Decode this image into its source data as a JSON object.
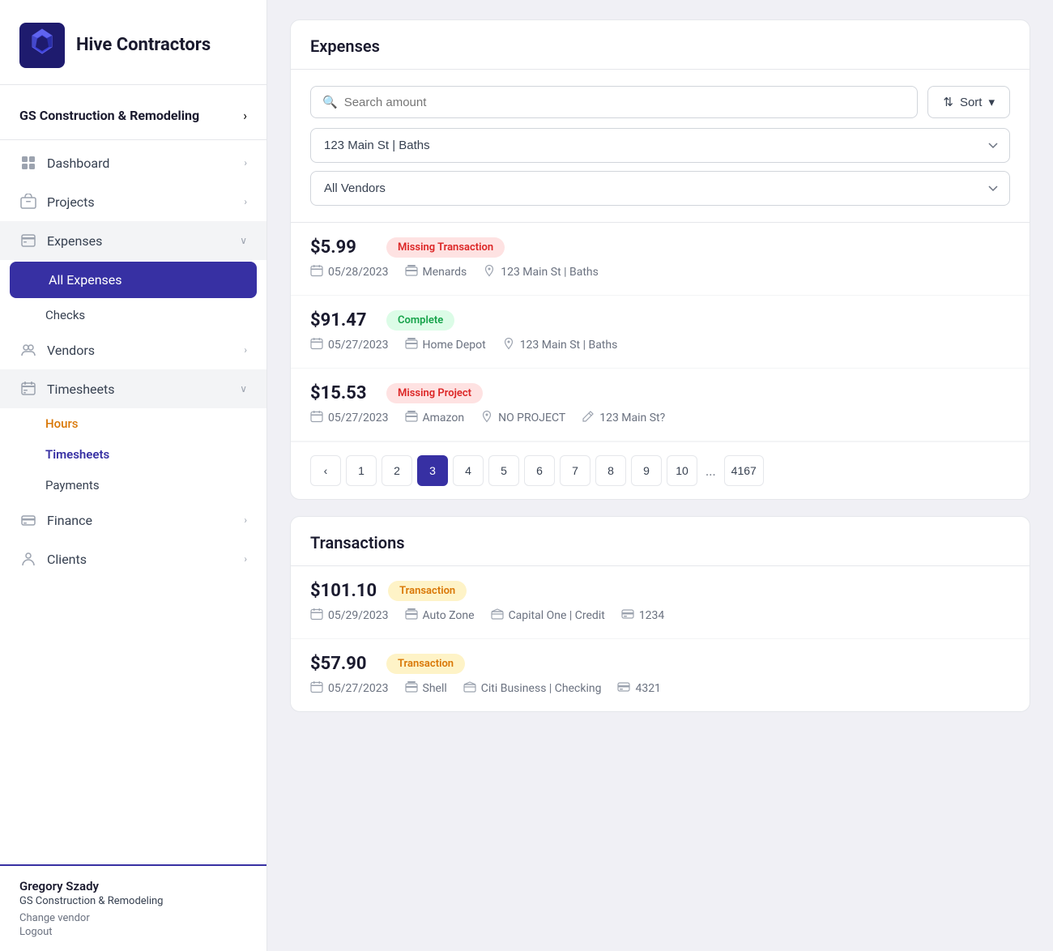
{
  "sidebar": {
    "brand": "Hive Contractors",
    "org": {
      "name": "GS Construction & Remodeling",
      "chevron": "›"
    },
    "nav_items": [
      {
        "id": "dashboard",
        "label": "Dashboard",
        "icon": "dashboard",
        "has_chevron": true
      },
      {
        "id": "projects",
        "label": "Projects",
        "icon": "projects",
        "has_chevron": true
      },
      {
        "id": "expenses",
        "label": "Expenses",
        "icon": "expenses",
        "has_chevron": true,
        "expanded": true
      },
      {
        "id": "all-expenses",
        "label": "All Expenses",
        "active": true
      },
      {
        "id": "checks",
        "label": "Checks"
      },
      {
        "id": "vendors",
        "label": "Vendors",
        "has_chevron": true
      },
      {
        "id": "timesheets",
        "label": "Timesheets",
        "icon": "timesheets",
        "has_chevron": true,
        "expanded": true
      },
      {
        "id": "hours",
        "label": "Hours",
        "highlight": "orange"
      },
      {
        "id": "timesheets-sub",
        "label": "Timesheets",
        "highlight": "purple"
      },
      {
        "id": "payments",
        "label": "Payments"
      },
      {
        "id": "finance",
        "label": "Finance",
        "icon": "finance",
        "has_chevron": true
      },
      {
        "id": "clients",
        "label": "Clients",
        "icon": "clients",
        "has_chevron": true
      }
    ],
    "user": {
      "name": "Gregory Szady",
      "company": "GS Construction & Remodeling",
      "change_vendor": "Change vendor",
      "logout": "Logout"
    }
  },
  "expenses": {
    "section_title": "Expenses",
    "search_placeholder": "Search amount",
    "sort_label": "Sort",
    "filter_project": "123 Main St | Baths",
    "filter_vendor": "All Vendors",
    "items": [
      {
        "amount": "$5.99",
        "badge": "Missing Transaction",
        "badge_type": "red",
        "date": "05/28/2023",
        "vendor": "Menards",
        "location": "123 Main St | Baths",
        "extra": null
      },
      {
        "amount": "$91.47",
        "badge": "Complete",
        "badge_type": "green",
        "date": "05/27/2023",
        "vendor": "Home Depot",
        "location": "123 Main St | Baths",
        "extra": null
      },
      {
        "amount": "$15.53",
        "badge": "Missing Project",
        "badge_type": "red",
        "date": "05/27/2023",
        "vendor": "Amazon",
        "location": "NO PROJECT",
        "extra": "123 Main St?"
      }
    ],
    "pagination": {
      "prev": "‹",
      "pages": [
        "1",
        "2",
        "3",
        "4",
        "5",
        "6",
        "7",
        "8",
        "9",
        "10"
      ],
      "ellipsis": "...",
      "last": "4167",
      "active_page": "3"
    }
  },
  "transactions": {
    "section_title": "Transactions",
    "items": [
      {
        "amount": "$101.10",
        "badge": "Transaction",
        "badge_type": "orange",
        "date": "05/29/2023",
        "vendor": "Auto Zone",
        "bank": "Capital One | Credit",
        "card": "1234"
      },
      {
        "amount": "$57.90",
        "badge": "Transaction",
        "badge_type": "orange",
        "date": "05/27/2023",
        "vendor": "Shell",
        "bank": "Citi Business | Checking",
        "card": "4321"
      }
    ]
  }
}
